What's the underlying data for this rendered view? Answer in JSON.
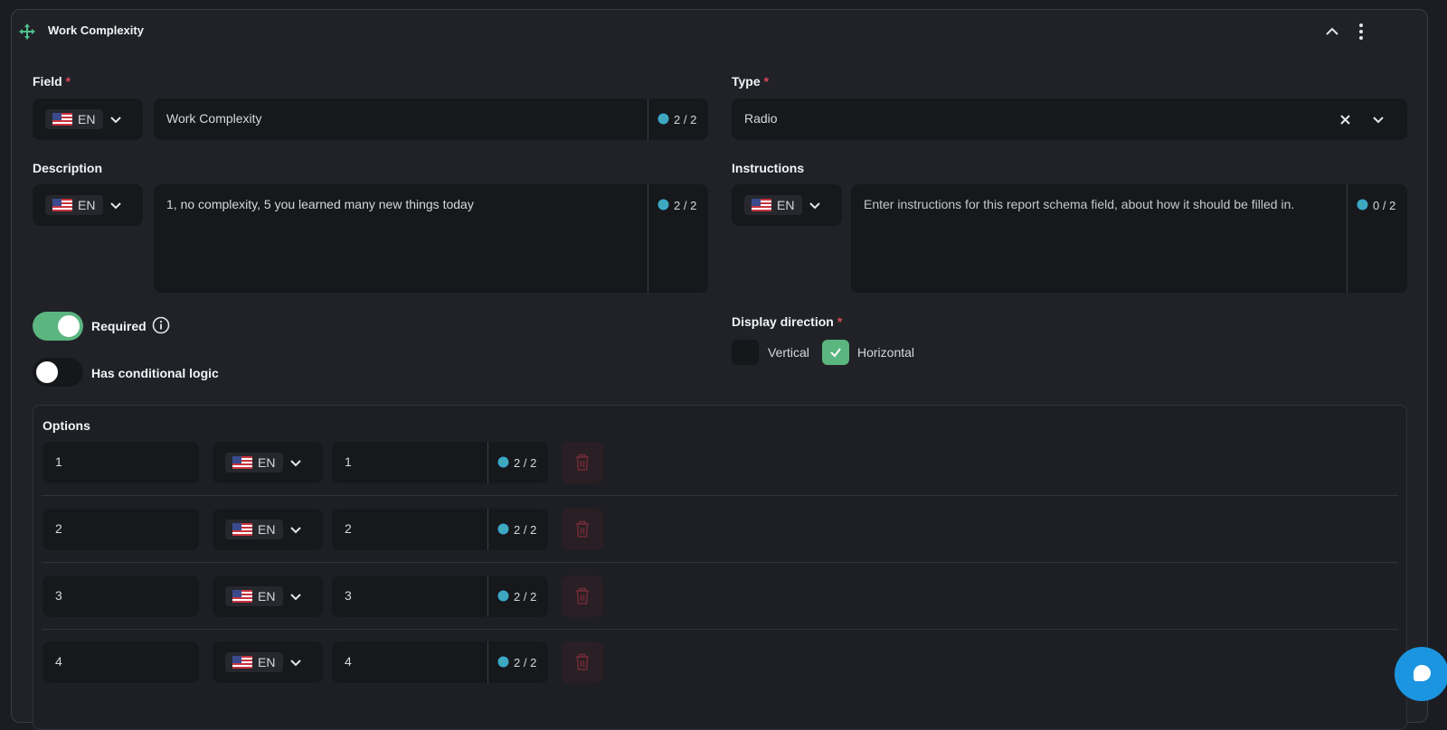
{
  "header": {
    "title": "Work Complexity",
    "move_icon": "move-icon",
    "collapse_icon": "chevron-up-icon",
    "menu_icon": "more-vertical-icon"
  },
  "field": {
    "label": "Field",
    "required_mark": "*",
    "lang": "EN",
    "value": "Work Complexity",
    "counter": "2 / 2"
  },
  "type": {
    "label": "Type",
    "required_mark": "*",
    "value": "Radio"
  },
  "description": {
    "label": "Description",
    "lang": "EN",
    "value": "1, no complexity, 5 you learned many new things today",
    "counter": "2 / 2"
  },
  "instructions": {
    "label": "Instructions",
    "lang": "EN",
    "placeholder": "Enter instructions for this report schema field, about how it should be filled in.",
    "counter": "0 / 2"
  },
  "required_toggle": {
    "label": "Required",
    "on": true
  },
  "conditional_toggle": {
    "label": "Has conditional logic",
    "on": false
  },
  "display_direction": {
    "label": "Display direction",
    "required_mark": "*",
    "options": [
      "Vertical",
      "Horizontal"
    ],
    "selected": "Horizontal"
  },
  "options": {
    "label": "Options",
    "rows": [
      {
        "value": "1",
        "lang": "EN",
        "label": "1",
        "counter": "2 / 2"
      },
      {
        "value": "2",
        "lang": "EN",
        "label": "2",
        "counter": "2 / 2"
      },
      {
        "value": "3",
        "lang": "EN",
        "label": "3",
        "counter": "2 / 2"
      },
      {
        "value": "4",
        "lang": "EN",
        "label": "4",
        "counter": "2 / 2"
      }
    ]
  },
  "colors": {
    "accent": "#5bb57f",
    "danger": "#d9475a",
    "chat": "#1c95e0"
  }
}
